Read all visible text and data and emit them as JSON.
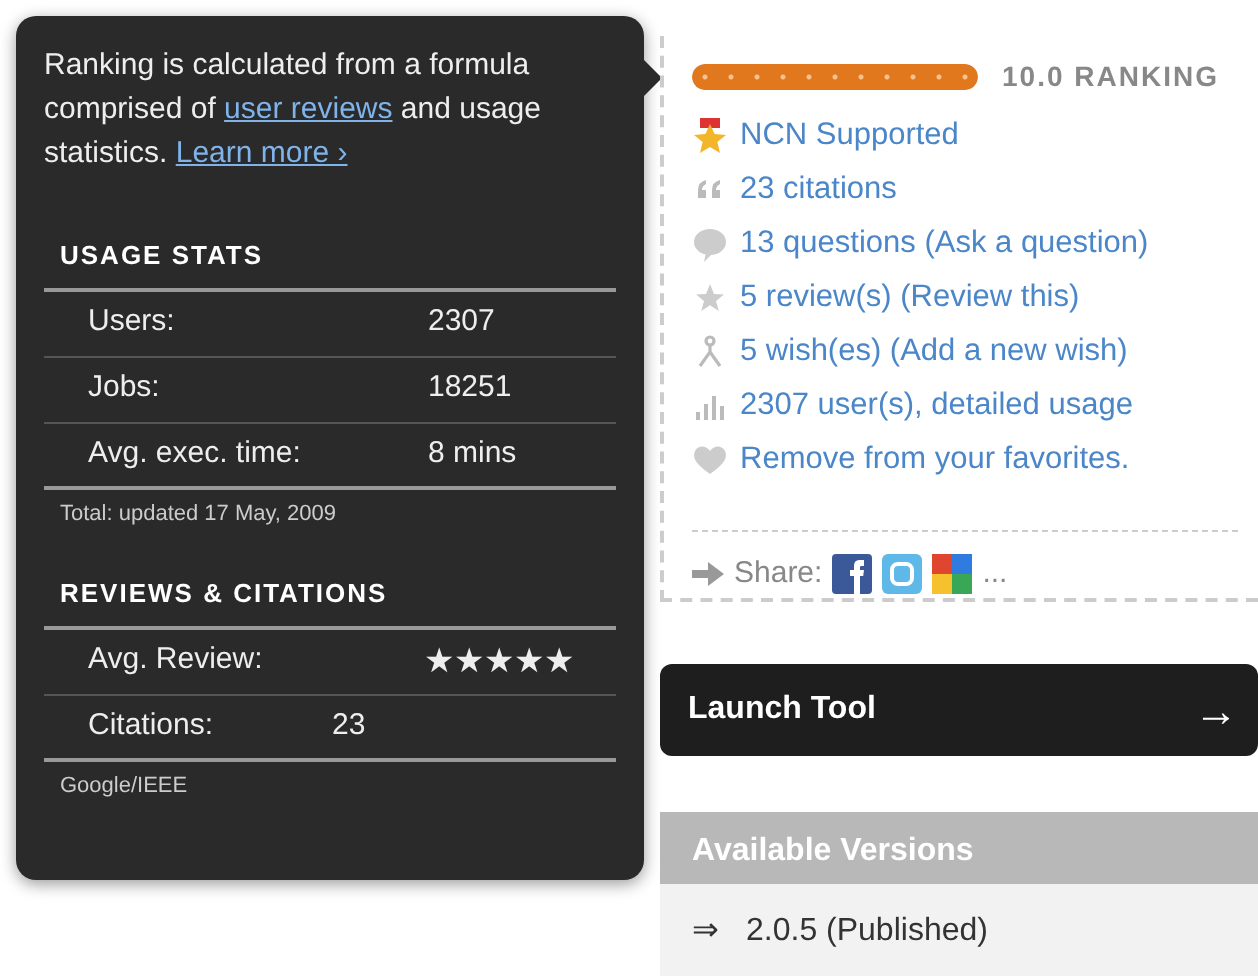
{
  "tooltip": {
    "intro": {
      "text_1": "Ranking is calculated from a formula comprised of ",
      "link_1": "user reviews",
      "text_2": " and usage statistics. ",
      "link_2": "Learn more ›"
    },
    "sections": [
      {
        "heading": "USAGE STATS",
        "rows": [
          {
            "kind": "text",
            "label": "Users:",
            "value": "2307"
          },
          {
            "kind": "text",
            "label": "Jobs:",
            "value": "18251"
          },
          {
            "kind": "text",
            "label": "Avg. exec. time:",
            "value": "8 mins"
          }
        ],
        "note": "Total: updated 17 May, 2009"
      },
      {
        "heading": "REVIEWS & CITATIONS",
        "rows": [
          {
            "kind": "stars",
            "label": "Avg. Review:",
            "stars": 5
          },
          {
            "kind": "text",
            "label": "Citations:",
            "value": "23"
          }
        ],
        "note": "Google/IEEE"
      }
    ]
  },
  "ranking": {
    "level": 1,
    "reading": "10.0 RANKING"
  },
  "stats": [
    {
      "kind": "medal",
      "text": "NCN Supported"
    },
    {
      "kind": "quote",
      "text": "23 citations"
    },
    {
      "kind": "question",
      "text": "13 questions (Ask a question)"
    },
    {
      "kind": "star",
      "text": "5 review(s) (Review this)"
    },
    {
      "kind": "wish",
      "text": "5 wish(es) (Add a new wish)"
    },
    {
      "kind": "chart",
      "text": "2307 user(s), detailed usage"
    },
    {
      "kind": "heart",
      "text": "Remove from your favorites."
    }
  ],
  "share": {
    "label": "Share:",
    "more": "..."
  },
  "launch": {
    "label": "Launch Tool",
    "arrow": "→"
  },
  "versions": {
    "heading": "Available Versions",
    "items": [
      {
        "arrow": "⇒",
        "label": "2.0.5 (Published)"
      }
    ]
  }
}
